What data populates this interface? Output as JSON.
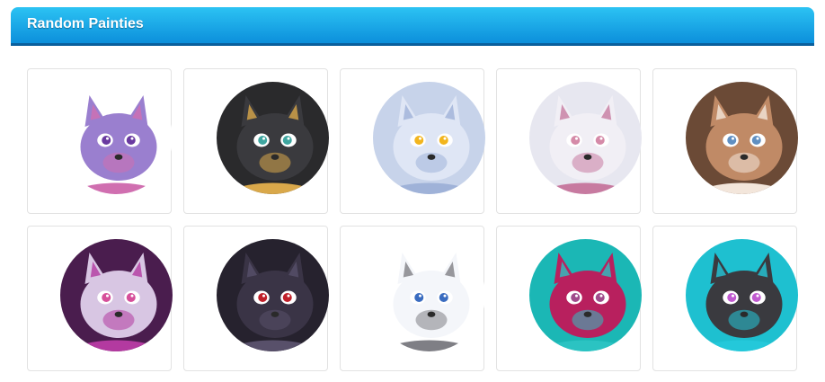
{
  "header": {
    "title": "Random Painties"
  },
  "colors": {
    "header_top": "#2cc3f3",
    "header_bottom": "#0c8fdb",
    "header_border": "#0a5f9c"
  },
  "avatars": [
    {
      "name": "purple-dragon-avatar",
      "bg": "#ffffff",
      "skin": "#9a7fcf",
      "accent": "#d06fb0",
      "eye": "#6a3aa0"
    },
    {
      "name": "black-bird-avatar",
      "bg": "#2a2a2c",
      "skin": "#3a3a3e",
      "accent": "#d9a84a",
      "eye": "#3fa6a0"
    },
    {
      "name": "white-dragon-avatar",
      "bg": "#c7d3ea",
      "skin": "#dfe6f5",
      "accent": "#9fb2d8",
      "eye": "#f2b51e"
    },
    {
      "name": "white-fox-avatar",
      "bg": "#e7e7f0",
      "skin": "#f1eff5",
      "accent": "#c77aa0",
      "eye": "#d58aa8"
    },
    {
      "name": "otter-avatar",
      "bg": "#6b4a36",
      "skin": "#c08a66",
      "accent": "#f3e6db",
      "eye": "#5f8fc2"
    },
    {
      "name": "shark-avatar",
      "bg": "#4a1d4e",
      "skin": "#d8c6e3",
      "accent": "#b33aa0",
      "eye": "#d64f9a"
    },
    {
      "name": "dark-wolf-avatar",
      "bg": "#26222e",
      "skin": "#3a3446",
      "accent": "#58506a",
      "eye": "#c0202a"
    },
    {
      "name": "polar-bear-avatar",
      "bg": "#ffffff",
      "skin": "#f4f6fa",
      "accent": "#7f7f85",
      "eye": "#3a6cc0"
    },
    {
      "name": "teal-pony-avatar",
      "bg": "#1bb7b5",
      "skin": "#b8205e",
      "accent": "#2bc3c2",
      "eye": "#a04b8c"
    },
    {
      "name": "black-cyan-dragon-avatar",
      "bg": "#1ec0d0",
      "skin": "#3a3a3f",
      "accent": "#24c8da",
      "eye": "#c05ad0"
    }
  ]
}
